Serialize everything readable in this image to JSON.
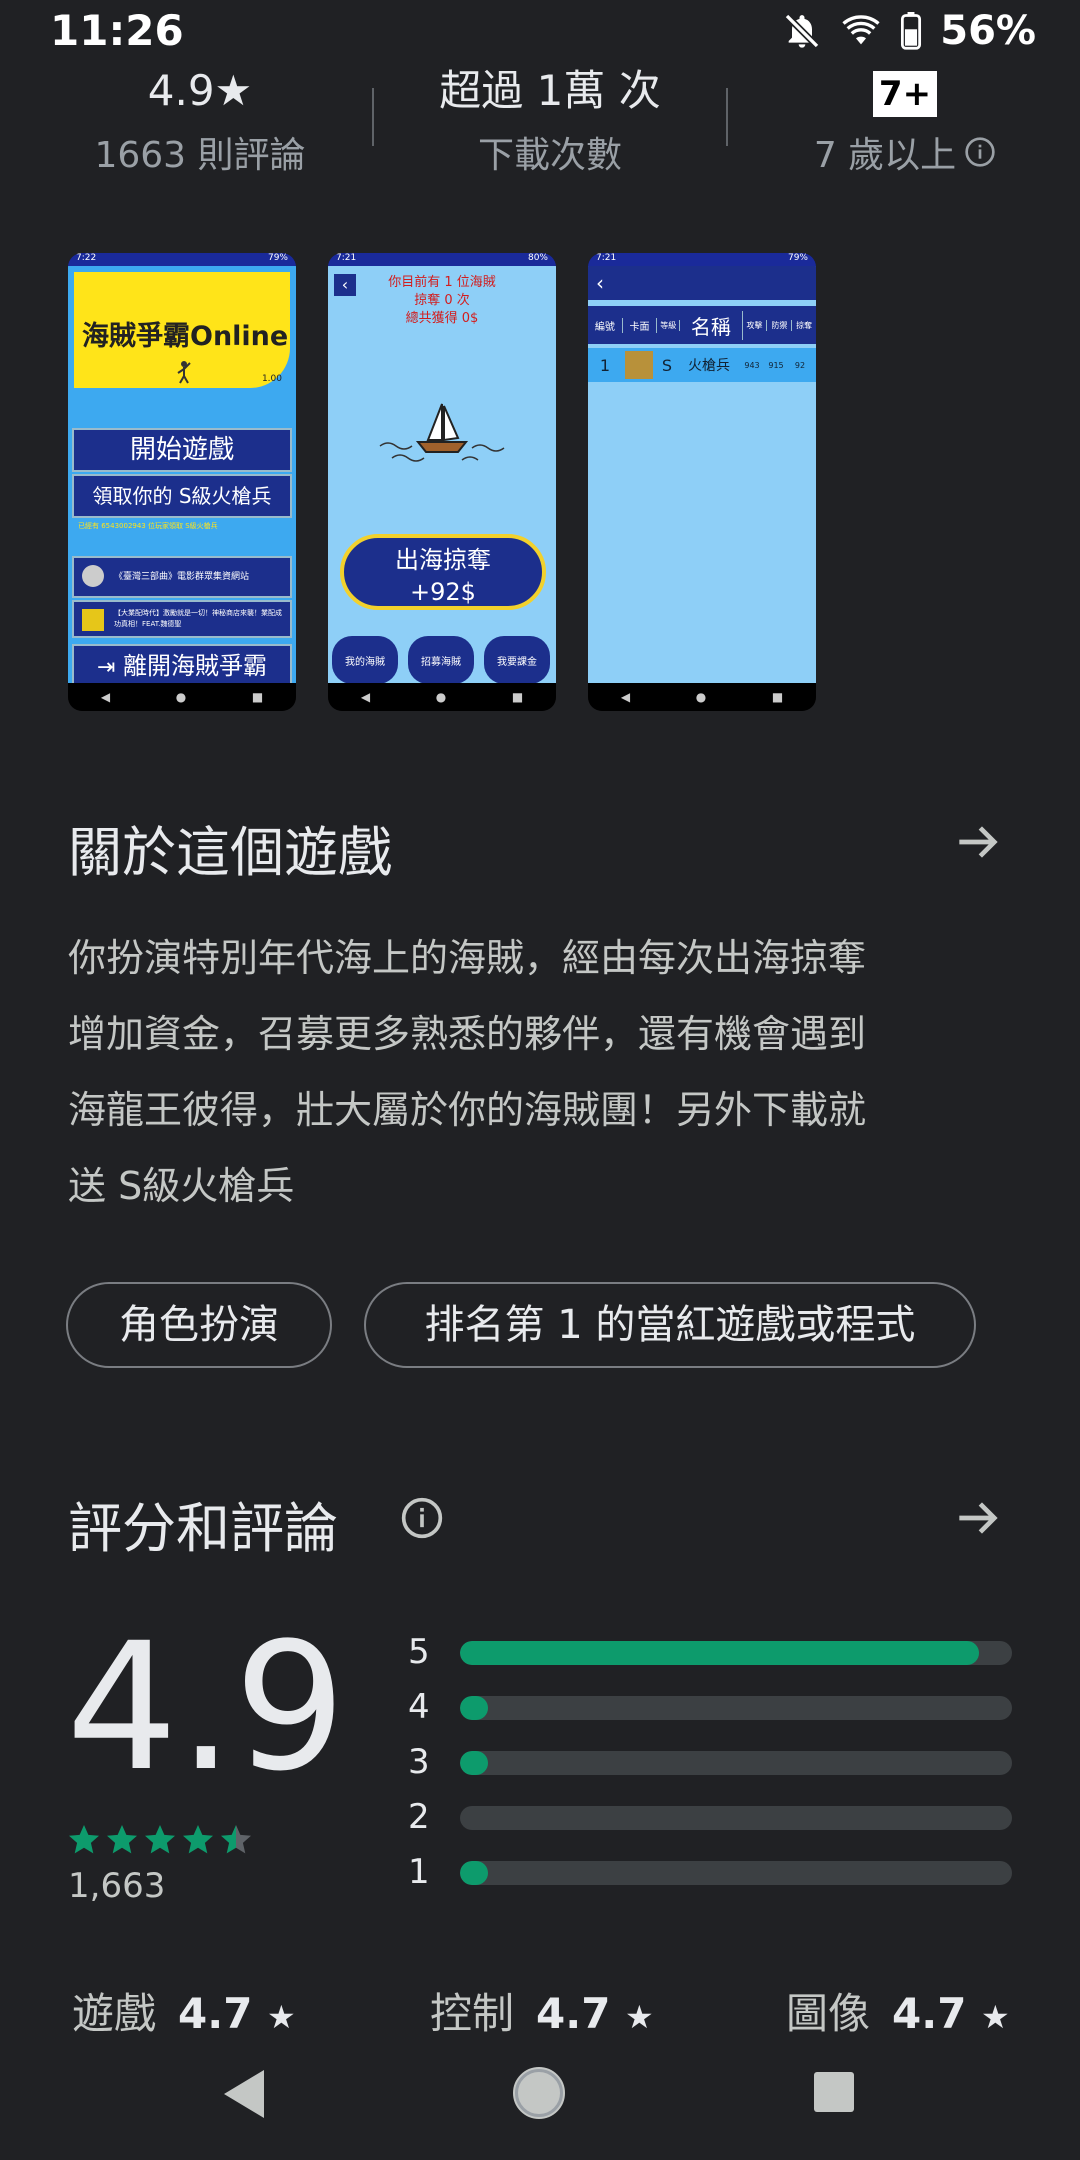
{
  "status_bar": {
    "time": "11:26",
    "battery": "56%"
  },
  "stats": {
    "rating": {
      "value": "4.9★",
      "label": "1663 則評論"
    },
    "downloads": {
      "value": "超過 1萬 次",
      "label": "下載次數"
    },
    "age": {
      "badge": "7+",
      "label": "7 歲以上"
    }
  },
  "screenshots": {
    "s1": {
      "status_time": "7:22",
      "status_batt": "79%",
      "banner": "海賊爭霸Online",
      "version": "1.00",
      "btn_start": "開始遊戲",
      "btn_claim": "領取你的 S級火槍兵",
      "note": "已經有 6543002943 位玩家領取 S級火槍兵",
      "link1": "《臺灣三部曲》電影群眾集資網站",
      "link2": "【大業配時代】激勵就是一切！神秘商店來襲！業配成功真相！FEAT.魏德聖",
      "btn_exit": "離開海賊爭霸"
    },
    "s2": {
      "status_time": "7:21",
      "status_batt": "80%",
      "line1": "你目前有 1 位海賊",
      "line2": "掠奪 0 次",
      "line3": "總共獲得 0$",
      "btn_main_1": "出海掠奪",
      "btn_main_2": "+92$",
      "btn_a": "我的海賊",
      "btn_b": "招募海賊",
      "btn_c": "我要課金"
    },
    "s3": {
      "status_time": "7:21",
      "status_batt": "79%",
      "headers": [
        "編號",
        "卡面",
        "等級",
        "名稱",
        "攻擊",
        "防禦",
        "掠奪"
      ],
      "row": [
        "1",
        "",
        "S",
        "火槍兵",
        "943",
        "915",
        "92"
      ]
    }
  },
  "about": {
    "title": "關於這個遊戲",
    "lines": [
      "你扮演特別年代海上的海賊，經由每次出海掠奪",
      "增加資金，召募更多熟悉的夥伴，還有機會遇到",
      "海龍王彼得，壯大屬於你的海賊團！另外下載就",
      "送 S級火槍兵"
    ],
    "tags": [
      "角色扮演",
      "排名第 1 的當紅遊戲或程式"
    ]
  },
  "ratings": {
    "title": "評分和評論",
    "score": "4.9",
    "stars_value": 4.5,
    "count": "1,663",
    "bars": [
      {
        "label": "5",
        "fraction": 0.94
      },
      {
        "label": "4",
        "fraction": 0.04
      },
      {
        "label": "3",
        "fraction": 0.04
      },
      {
        "label": "2",
        "fraction": 0.0
      },
      {
        "label": "1",
        "fraction": 0.04
      }
    ],
    "sub": [
      {
        "label": "遊戲",
        "value": "4.7",
        "star": "★"
      },
      {
        "label": "控制",
        "value": "4.7",
        "star": "★"
      },
      {
        "label": "圖像",
        "value": "4.7",
        "star": "★"
      }
    ]
  },
  "colors": {
    "accent": "#0d9b6c",
    "background": "#202124"
  }
}
